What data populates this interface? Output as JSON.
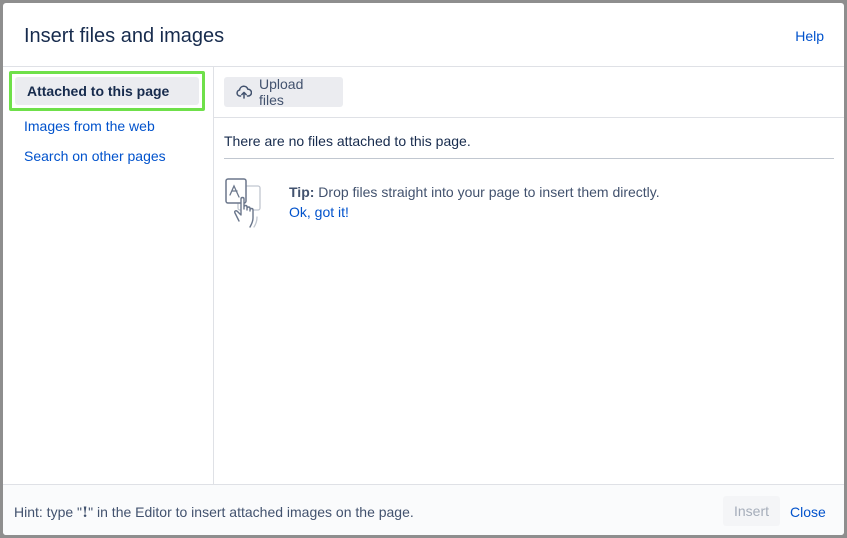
{
  "dialog": {
    "title": "Insert files and images",
    "help_label": "Help"
  },
  "sidebar": {
    "items": [
      {
        "label": "Attached to this page",
        "active": true
      },
      {
        "label": "Images from the web",
        "active": false
      },
      {
        "label": "Search on other pages",
        "active": false
      }
    ]
  },
  "toolbar": {
    "upload_label": "Upload files",
    "upload_icon": "cloud-upload-icon"
  },
  "main": {
    "empty_message": "There are no files attached to this page.",
    "tip": {
      "label": "Tip:",
      "text": " Drop files straight into your page to insert them directly.",
      "ok_label": "Ok, got it!",
      "illustration": "drag-file-hand-icon"
    }
  },
  "footer": {
    "hint_prefix": "Hint: type \"",
    "hint_key": "!",
    "hint_suffix": "\" in the Editor to insert attached images on the page.",
    "insert_label": "Insert",
    "close_label": "Close"
  },
  "colors": {
    "accent_link": "#0052cc",
    "highlight_border": "#6fe04a",
    "text_primary": "#172b4d"
  }
}
